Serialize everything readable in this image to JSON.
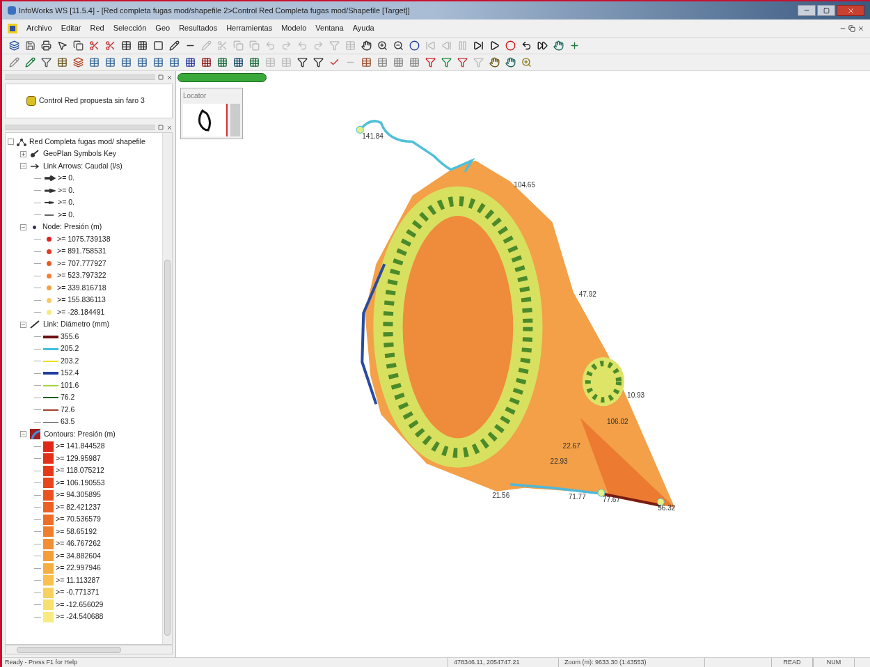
{
  "window": {
    "title": "InfoWorks WS [11.5.4] - [Red completa fugas mod/shapefile 2>Control Red Completa fugas mod/Shapefile  [Target]]"
  },
  "menu": [
    "Archivo",
    "Editar",
    "Red",
    "Selección",
    "Geo",
    "Resultados",
    "Herramientas",
    "Modelo",
    "Ventana",
    "Ayuda"
  ],
  "model_group": {
    "items": [
      {
        "label": "Control Red propuesta sin faro 3"
      }
    ]
  },
  "legend": {
    "root": "Red Completa fugas mod/ shapefile",
    "groups": [
      {
        "kind": "symbols",
        "label": "GeoPlan Symbols Key",
        "expanded": false
      },
      {
        "kind": "arrows",
        "label": "Link Arrows: Caudal (l/s)",
        "expanded": true,
        "items": [
          {
            "label": ">= 0."
          },
          {
            "label": ">= 0."
          },
          {
            "label": ">= 0."
          },
          {
            "label": ">= 0."
          }
        ]
      },
      {
        "kind": "nodes",
        "label": "Node: Presión (m)",
        "expanded": true,
        "items": [
          {
            "label": ">= 1075.739138",
            "color": "#e02020"
          },
          {
            "label": ">= 891.758531",
            "color": "#e23a22"
          },
          {
            "label": ">= 707.777927",
            "color": "#e85a20"
          },
          {
            "label": ">= 523.797322",
            "color": "#f08030"
          },
          {
            "label": ">= 339.816718",
            "color": "#f0a040"
          },
          {
            "label": ">= 155.836113",
            "color": "#f8c860"
          },
          {
            "label": ">= -28.184491",
            "color": "#f8e878"
          }
        ]
      },
      {
        "kind": "links",
        "label": "Link: Diámetro (mm)",
        "expanded": true,
        "items": [
          {
            "label": "355.6",
            "color": "#6b1010"
          },
          {
            "label": "205.2",
            "color": "#40c0e0"
          },
          {
            "label": "203.2",
            "color": "#e8e020"
          },
          {
            "label": "152.4",
            "color": "#2040a0"
          },
          {
            "label": "101.6",
            "color": "#a0d840"
          },
          {
            "label": "76.2",
            "color": "#206020"
          },
          {
            "label": "72.6",
            "color": "#a04030"
          },
          {
            "label": "63.5",
            "color": "#505050"
          }
        ]
      },
      {
        "kind": "contours",
        "label": "Contours: Presión (m)",
        "expanded": true,
        "items": [
          {
            "label": ">= 141.844528",
            "color": "#e02818"
          },
          {
            "label": ">= 129.95987",
            "color": "#e33018"
          },
          {
            "label": ">= 118.075212",
            "color": "#e53a1a"
          },
          {
            "label": ">= 106.190553",
            "color": "#e8461c"
          },
          {
            "label": ">= 94.305895",
            "color": "#ea5220"
          },
          {
            "label": ">= 82.421237",
            "color": "#ec6024"
          },
          {
            "label": ">= 70.536579",
            "color": "#ee6e28"
          },
          {
            "label": ">= 58.65192",
            "color": "#f07e2e"
          },
          {
            "label": ">= 46.767262",
            "color": "#f28e34"
          },
          {
            "label": ">= 34.882604",
            "color": "#f49e3a"
          },
          {
            "label": ">= 22.997946",
            "color": "#f6ae42"
          },
          {
            "label": ">= 11.113287",
            "color": "#f8c050"
          },
          {
            "label": ">= -0.771371",
            "color": "#f8d060"
          },
          {
            "label": ">= -12.656029",
            "color": "#f8e070"
          },
          {
            "label": ">= -24.540688",
            "color": "#f8ec80"
          }
        ]
      }
    ]
  },
  "locator": {
    "title": "Locator"
  },
  "map": {
    "labels": [
      "141.84",
      "104.65",
      "47.92",
      "10.93",
      "106.02",
      "22.67",
      "22.93",
      "21.56",
      "71.77",
      "77.67",
      "56.32"
    ]
  },
  "status_bar": {
    "message": "Ready - Press F1 for Help",
    "coordinates": "478346.11, 2054747.21",
    "zoom": "Zoom (m): 9633.30 (1:43553)",
    "indicators": [
      "READ",
      "NUM"
    ]
  }
}
